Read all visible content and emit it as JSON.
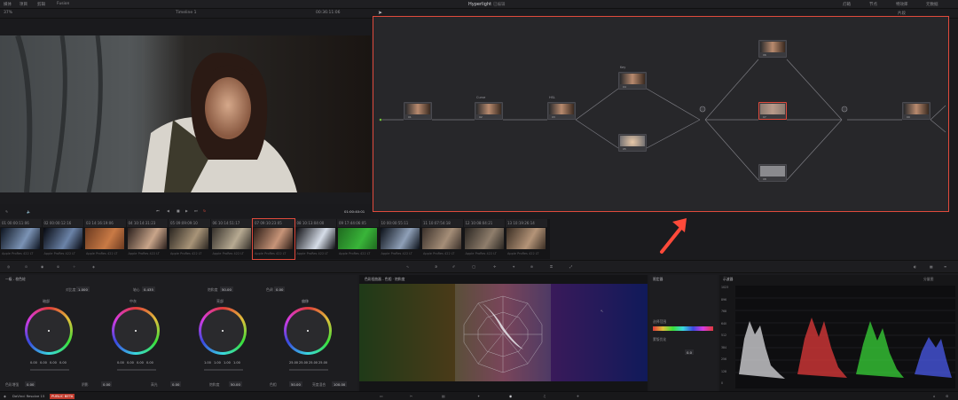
{
  "topbar": {
    "left_items": [
      "媒体",
      "项目",
      "剪辑",
      "Fusion"
    ],
    "title": "Hyperlight",
    "subtitle": "已编辑",
    "right_items": [
      "灯箱",
      "节点",
      "特效库",
      "元数据"
    ]
  },
  "subbar": {
    "zoom": "37%",
    "timeline_name": "Timeline 1",
    "timecode": "00:36:11:06",
    "node_mode": "片段"
  },
  "viewer": {
    "timecode": "01:00:40:01"
  },
  "clips": [
    {
      "num": "01",
      "tc": "00:00:11:06",
      "cap": "Apple ProRes 422 LT",
      "c1": "#0d1420",
      "c2": "#7b93b5"
    },
    {
      "num": "02",
      "tc": "00:00:12:16",
      "cap": "Apple ProRes 422 LT",
      "c1": "#06080f",
      "c2": "#6b83a8"
    },
    {
      "num": "03",
      "tc": "14:16:19:06",
      "cap": "Apple ProRes 422 LT",
      "c1": "#6b3a20",
      "c2": "#c97a45"
    },
    {
      "num": "04",
      "tc": "10:14:31:23",
      "cap": "Apple ProRes 422 LT",
      "c1": "#2a1f1c",
      "c2": "#c9a58a"
    },
    {
      "num": "05",
      "tc": "09:09:09:10",
      "cap": "Apple ProRes 422 LT",
      "c1": "#2a2520",
      "c2": "#a89478"
    },
    {
      "num": "06",
      "tc": "10:14:51:17",
      "cap": "Apple ProRes 422 LT",
      "c1": "#35302a",
      "c2": "#b7aa92"
    },
    {
      "num": "07",
      "tc": "09:10:23:05",
      "cap": "Apple ProRes 422 LT",
      "c1": "#2b1c16",
      "c2": "#c79478"
    },
    {
      "num": "08",
      "tc": "10:13:04:00",
      "cap": "Apple ProRes 422 LT",
      "c1": "#0e0e12",
      "c2": "#d6dde8"
    },
    {
      "num": "09",
      "tc": "17:44:06:05",
      "cap": "Apple ProRes 422 LT",
      "c1": "#1f6a1f",
      "c2": "#39b539"
    },
    {
      "num": "10",
      "tc": "00:00:55:11",
      "cap": "Apple ProRes 422 LT",
      "c1": "#0b1018",
      "c2": "#8fa0b8"
    },
    {
      "num": "11",
      "tc": "10:07:54:18",
      "cap": "Apple ProRes 422 LT",
      "c1": "#3a302a",
      "c2": "#a58e78"
    },
    {
      "num": "12",
      "tc": "10:08:04:21",
      "cap": "Apple ProRes 422 LT",
      "c1": "#2a2622",
      "c2": "#8f7e6c"
    },
    {
      "num": "13",
      "tc": "10:19:26:14",
      "cap": "Apple ProRes 422 LT",
      "c1": "#3a2e24",
      "c2": "#b49478"
    }
  ],
  "nodes": {
    "n1": {
      "label": "01"
    },
    "n2": {
      "name": "Curve",
      "label": "02"
    },
    "n3": {
      "name": "HSL",
      "label": "03"
    },
    "n4": {
      "name": "Key",
      "label": "04"
    },
    "n5": {
      "label": "05"
    },
    "n6": {
      "label": "06"
    },
    "n7": {
      "label": "07"
    },
    "n8": {
      "label": "08"
    },
    "n9": {
      "label": "09"
    }
  },
  "wheels": {
    "panel_title": "一级 - 校色轮",
    "contrast_label": "对比度",
    "contrast_val": "1.000",
    "pivot_label": "轴心",
    "pivot_val": "0.435",
    "sat_label": "饱和度",
    "sat_val": "50.00",
    "tint_label": "色调",
    "tint_val": "0.00",
    "items": [
      {
        "name": "暗部",
        "values": [
          "0.00",
          "0.00",
          "0.00",
          "0.00"
        ]
      },
      {
        "name": "中灰",
        "values": [
          "0.00",
          "0.00",
          "0.00",
          "0.00"
        ]
      },
      {
        "name": "亮部",
        "values": [
          "1.00",
          "1.00",
          "1.00",
          "1.00"
        ]
      },
      {
        "name": "偏移",
        "values": [
          "25.00",
          "25.00",
          "25.00",
          "25.00"
        ]
      }
    ],
    "bottom": [
      {
        "label": "色彩增强",
        "val": "0.00"
      },
      {
        "label": "阴影",
        "val": "0.00"
      },
      {
        "label": "高光",
        "val": "0.00"
      },
      {
        "label": "饱和度",
        "val": "50.00"
      },
      {
        "label": "色相",
        "val": "50.00"
      },
      {
        "label": "亮度混合",
        "val": "100.00"
      }
    ]
  },
  "vector": {
    "title": "色彩扭曲器 - 色相 · 饱和度"
  },
  "qualifier": {
    "title": "限定器",
    "row1": "选择范围",
    "row2": "蒙版优化",
    "val": "0.0"
  },
  "scopes": {
    "title": "示波器",
    "mode": "分量图",
    "scale": [
      "1023",
      "896",
      "768",
      "640",
      "512",
      "384",
      "256",
      "128",
      "0"
    ]
  },
  "statusbar": {
    "app": "DaVinci Resolve 15",
    "badge": "PUBLIC BETA"
  },
  "colors": {
    "accent": "#e04a3c",
    "node_green": "#6fbf3a"
  }
}
